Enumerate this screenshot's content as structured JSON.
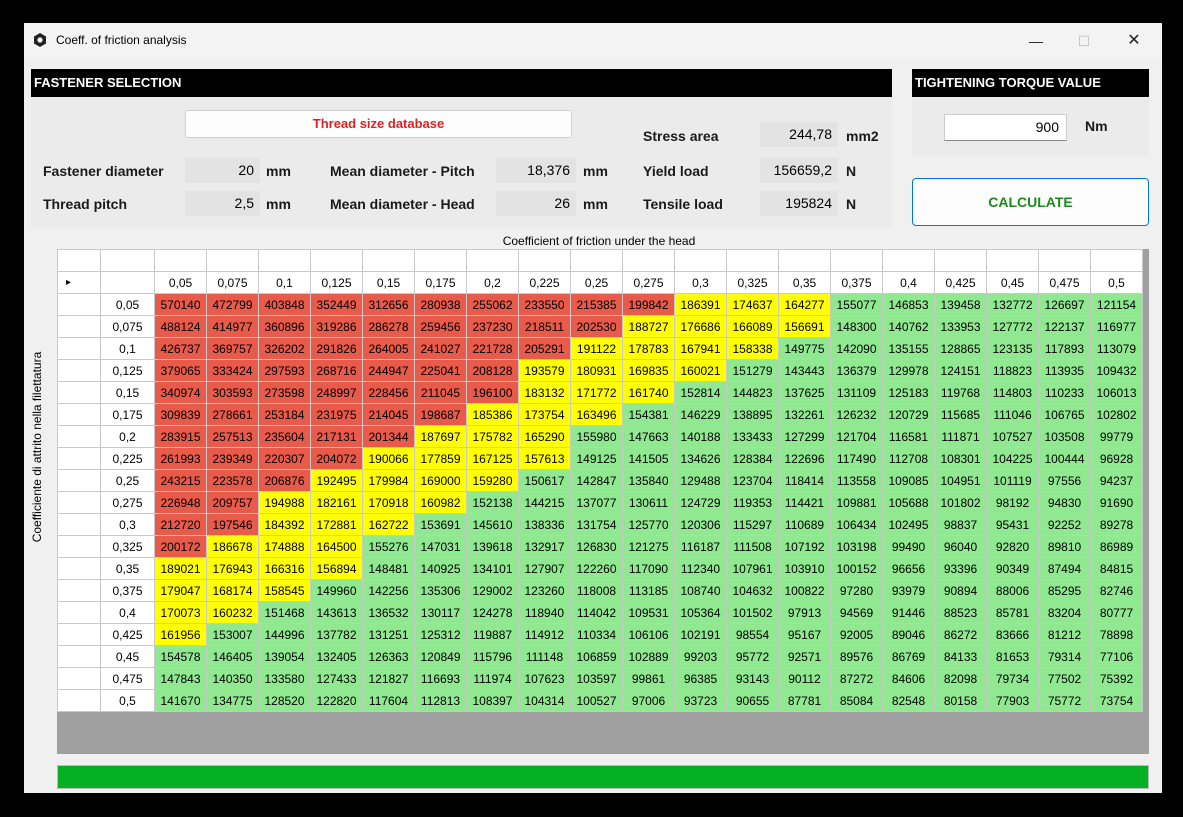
{
  "window": {
    "title": "Coeff. of friction analysis",
    "minimize": "—",
    "maximize": "☐",
    "close": "✕"
  },
  "fastener": {
    "header": "FASTENER SELECTION",
    "db_button": "Thread size database",
    "diameter_label": "Fastener diameter",
    "diameter_value": "20",
    "diameter_unit": "mm",
    "pitch_label": "Thread pitch",
    "pitch_value": "2,5",
    "pitch_unit": "mm",
    "mean_pitch_label": "Mean diameter - Pitch",
    "mean_pitch_value": "18,376",
    "mean_pitch_unit": "mm",
    "mean_head_label": "Mean diameter - Head",
    "mean_head_value": "26",
    "mean_head_unit": "mm",
    "stress_label": "Stress area",
    "stress_value": "244,78",
    "stress_unit": "mm2",
    "yield_label": "Yield load",
    "yield_value": "156659,2",
    "yield_unit": "N",
    "tensile_label": "Tensile load",
    "tensile_value": "195824",
    "tensile_unit": "N"
  },
  "torque": {
    "header": "TIGHTENING TORQUE VALUE",
    "value": "900",
    "unit": "Nm",
    "calculate": "CALCULATE"
  },
  "grid": {
    "title": "Coefficient of friction under the head",
    "row_axis_label": "Coefficiente di attrito nella filettatura",
    "row_indicator": "▸",
    "columns": [
      "0,05",
      "0,075",
      "0,1",
      "0,125",
      "0,15",
      "0,175",
      "0,2",
      "0,225",
      "0,25",
      "0,275",
      "0,3",
      "0,325",
      "0,35",
      "0,375",
      "0,4",
      "0,425",
      "0,45",
      "0,475",
      "0,5"
    ],
    "rows": [
      {
        "mu": "0,05",
        "values": [
          "570140",
          "472799",
          "403848",
          "352449",
          "312656",
          "280938",
          "255062",
          "233550",
          "215385",
          "199842",
          "186391",
          "174637",
          "164277",
          "155077",
          "146853",
          "139458",
          "132772",
          "126697",
          "121154"
        ]
      },
      {
        "mu": "0,075",
        "values": [
          "488124",
          "414977",
          "360896",
          "319286",
          "286278",
          "259456",
          "237230",
          "218511",
          "202530",
          "188727",
          "176686",
          "166089",
          "156691",
          "148300",
          "140762",
          "133953",
          "127772",
          "122137",
          "116977"
        ]
      },
      {
        "mu": "0,1",
        "values": [
          "426737",
          "369757",
          "326202",
          "291826",
          "264005",
          "241027",
          "221728",
          "205291",
          "191122",
          "178783",
          "167941",
          "158338",
          "149775",
          "142090",
          "135155",
          "128865",
          "123135",
          "117893",
          "113079"
        ]
      },
      {
        "mu": "0,125",
        "values": [
          "379065",
          "333424",
          "297593",
          "268716",
          "244947",
          "225041",
          "208128",
          "193579",
          "180931",
          "169835",
          "160021",
          "151279",
          "143443",
          "136379",
          "129978",
          "124151",
          "118823",
          "113935",
          "109432"
        ]
      },
      {
        "mu": "0,15",
        "values": [
          "340974",
          "303593",
          "273598",
          "248997",
          "228456",
          "211045",
          "196100",
          "183132",
          "171772",
          "161740",
          "152814",
          "144823",
          "137625",
          "131109",
          "125183",
          "119768",
          "114803",
          "110233",
          "106013"
        ]
      },
      {
        "mu": "0,175",
        "values": [
          "309839",
          "278661",
          "253184",
          "231975",
          "214045",
          "198687",
          "185386",
          "173754",
          "163496",
          "154381",
          "146229",
          "138895",
          "132261",
          "126232",
          "120729",
          "115685",
          "111046",
          "106765",
          "102802"
        ]
      },
      {
        "mu": "0,2",
        "values": [
          "283915",
          "257513",
          "235604",
          "217131",
          "201344",
          "187697",
          "175782",
          "165290",
          "155980",
          "147663",
          "140188",
          "133433",
          "127299",
          "121704",
          "116581",
          "111871",
          "107527",
          "103508",
          "99779"
        ]
      },
      {
        "mu": "0,225",
        "values": [
          "261993",
          "239349",
          "220307",
          "204072",
          "190066",
          "177859",
          "167125",
          "157613",
          "149125",
          "141505",
          "134626",
          "128384",
          "122696",
          "117490",
          "112708",
          "108301",
          "104225",
          "100444",
          "96928"
        ]
      },
      {
        "mu": "0,25",
        "values": [
          "243215",
          "223578",
          "206876",
          "192495",
          "179984",
          "169000",
          "159280",
          "150617",
          "142847",
          "135840",
          "129488",
          "123704",
          "118414",
          "113558",
          "109085",
          "104951",
          "101119",
          "97556",
          "94237"
        ]
      },
      {
        "mu": "0,275",
        "values": [
          "226948",
          "209757",
          "194988",
          "182161",
          "170918",
          "160982",
          "152138",
          "144215",
          "137077",
          "130611",
          "124729",
          "119353",
          "114421",
          "109881",
          "105688",
          "101802",
          "98192",
          "94830",
          "91690"
        ]
      },
      {
        "mu": "0,3",
        "values": [
          "212720",
          "197546",
          "184392",
          "172881",
          "162722",
          "153691",
          "145610",
          "138336",
          "131754",
          "125770",
          "120306",
          "115297",
          "110689",
          "106434",
          "102495",
          "98837",
          "95431",
          "92252",
          "89278"
        ]
      },
      {
        "mu": "0,325",
        "values": [
          "200172",
          "186678",
          "174888",
          "164500",
          "155276",
          "147031",
          "139618",
          "132917",
          "126830",
          "121275",
          "116187",
          "111508",
          "107192",
          "103198",
          "99490",
          "96040",
          "92820",
          "89810",
          "86989"
        ]
      },
      {
        "mu": "0,35",
        "values": [
          "189021",
          "176943",
          "166316",
          "156894",
          "148481",
          "140925",
          "134101",
          "127907",
          "122260",
          "117090",
          "112340",
          "107961",
          "103910",
          "100152",
          "96656",
          "93396",
          "90349",
          "87494",
          "84815"
        ]
      },
      {
        "mu": "0,375",
        "values": [
          "179047",
          "168174",
          "158545",
          "149960",
          "142256",
          "135306",
          "129002",
          "123260",
          "118008",
          "113185",
          "108740",
          "104632",
          "100822",
          "97280",
          "93979",
          "90894",
          "88006",
          "85295",
          "82746"
        ]
      },
      {
        "mu": "0,4",
        "values": [
          "170073",
          "160232",
          "151468",
          "143613",
          "136532",
          "130117",
          "124278",
          "118940",
          "114042",
          "109531",
          "105364",
          "101502",
          "97913",
          "94569",
          "91446",
          "88523",
          "85781",
          "83204",
          "80777"
        ]
      },
      {
        "mu": "0,425",
        "values": [
          "161956",
          "153007",
          "144996",
          "137782",
          "131251",
          "125312",
          "119887",
          "114912",
          "110334",
          "106106",
          "102191",
          "98554",
          "95167",
          "92005",
          "89046",
          "86272",
          "83666",
          "81212",
          "78898"
        ]
      },
      {
        "mu": "0,45",
        "values": [
          "154578",
          "146405",
          "139054",
          "132405",
          "126363",
          "120849",
          "115796",
          "111148",
          "106859",
          "102889",
          "99203",
          "95772",
          "92571",
          "89576",
          "86769",
          "84133",
          "81653",
          "79314",
          "77106"
        ]
      },
      {
        "mu": "0,475",
        "values": [
          "147843",
          "140350",
          "133580",
          "127433",
          "121827",
          "116693",
          "111974",
          "107623",
          "103597",
          "99861",
          "96385",
          "93143",
          "90112",
          "87272",
          "84606",
          "82098",
          "79734",
          "77502",
          "75392"
        ]
      },
      {
        "mu": "0,5",
        "values": [
          "141670",
          "134775",
          "128520",
          "122820",
          "117604",
          "112813",
          "108397",
          "104314",
          "100527",
          "97006",
          "93723",
          "90655",
          "87781",
          "85084",
          "82548",
          "80158",
          "77903",
          "75772",
          "73754"
        ]
      }
    ],
    "thresholds": {
      "tensile": 195824,
      "yield": 156659.2
    }
  },
  "colors": {
    "red": "#e85a4a",
    "yellow": "#ffff00",
    "green": "#90e890",
    "progress": "#06b025"
  },
  "progress": {
    "percent": 100
  }
}
